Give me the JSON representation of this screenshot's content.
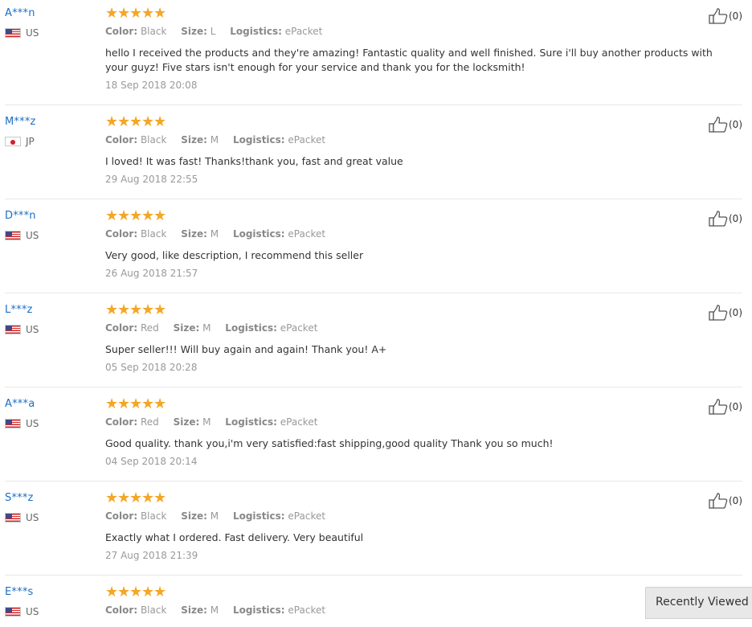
{
  "labels": {
    "color": "Color:",
    "size": "Size:",
    "logistics": "Logistics:"
  },
  "accent_colors": {
    "star": "#f5a623",
    "username": "#1a6fc4"
  },
  "reviews": [
    {
      "user": "A***n",
      "country": "US",
      "flag": "us-flag",
      "rating": 5,
      "color": "Black",
      "size": "L",
      "logistics": "ePacket",
      "text": "hello I received the products and they're amazing! Fantastic quality and well finished. Sure i'll buy another products with your guyz! Five stars isn't enough for your service and thank you for the locksmith!",
      "date": "18 Sep 2018 20:08",
      "helpful": "(0)"
    },
    {
      "user": "M***z",
      "country": "JP",
      "flag": "jp-flag",
      "rating": 5,
      "color": "Black",
      "size": "M",
      "logistics": "ePacket",
      "text": "I loved! It was fast! Thanks!thank you, fast and great value",
      "date": "29 Aug 2018 22:55",
      "helpful": "(0)"
    },
    {
      "user": "D***n",
      "country": "US",
      "flag": "us-flag",
      "rating": 5,
      "color": "Black",
      "size": "M",
      "logistics": "ePacket",
      "text": "Very good, like description, I recommend this seller",
      "date": "26 Aug 2018 21:57",
      "helpful": "(0)"
    },
    {
      "user": "L***z",
      "country": "US",
      "flag": "us-flag",
      "rating": 5,
      "color": "Red",
      "size": "M",
      "logistics": "ePacket",
      "text": "Super seller!!! Will buy again and again! Thank you! A+",
      "date": "05 Sep 2018 20:28",
      "helpful": "(0)"
    },
    {
      "user": "A***a",
      "country": "US",
      "flag": "us-flag",
      "rating": 5,
      "color": "Red",
      "size": "M",
      "logistics": "ePacket",
      "text": "Good quality. thank you,i'm very satisfied:fast shipping,good quality Thank you so much!",
      "date": "04 Sep 2018 20:14",
      "helpful": "(0)"
    },
    {
      "user": "S***z",
      "country": "US",
      "flag": "us-flag",
      "rating": 5,
      "color": "Black",
      "size": "M",
      "logistics": "ePacket",
      "text": "Exactly what I ordered. Fast delivery. Very beautiful",
      "date": "27 Aug 2018 21:39",
      "helpful": "(0)"
    },
    {
      "user": "E***s",
      "country": "US",
      "flag": "us-flag",
      "rating": 5,
      "color": "Black",
      "size": "M",
      "logistics": "ePacket",
      "text": "",
      "date": "",
      "helpful": ""
    }
  ],
  "recently_viewed": {
    "label": "Recently Viewed"
  }
}
